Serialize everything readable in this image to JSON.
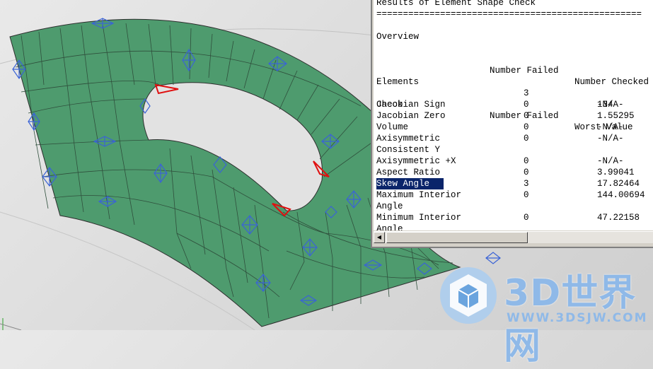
{
  "window_title": "Results of Element Shape Check",
  "separator": "==================================================",
  "overview": {
    "heading": "Overview",
    "col_failed": "Number Failed",
    "col_checked": "Number Checked",
    "row_label": "Elements",
    "failed": "3",
    "checked": "134"
  },
  "checks": {
    "col_check": "Check",
    "col_failed": "Number Failed",
    "col_worst": "Worst Value",
    "rows": [
      {
        "label": "Jacobian Sign",
        "failed": "0",
        "worst": "-N/A-"
      },
      {
        "label": "Jacobian Zero",
        "failed": "0",
        "worst": "1.55295"
      },
      {
        "label": "Volume",
        "failed": "0",
        "worst": "-N/A-"
      },
      {
        "label": "Axisymmetric",
        "failed": "0",
        "worst": "-N/A-"
      },
      {
        "label": "Consistent Y",
        "failed": "",
        "worst": ""
      },
      {
        "label": "Axisymmetric +X",
        "failed": "0",
        "worst": "-N/A-"
      },
      {
        "label": "Aspect Ratio",
        "failed": "0",
        "worst": "3.99041"
      },
      {
        "label": "Skew Angle",
        "failed": "3",
        "worst": "17.82464",
        "selected": true
      },
      {
        "label": "Maximum Interior",
        "failed": "0",
        "worst": "144.00694"
      },
      {
        "label": "Angle",
        "failed": "",
        "worst": ""
      },
      {
        "label": "Minimum Interior",
        "failed": "0",
        "worst": "47.22158"
      },
      {
        "label": "Angle",
        "failed": "",
        "worst": ""
      }
    ]
  },
  "watermark": {
    "title": "3D世界网",
    "url": "WWW.3DSJW.COM"
  },
  "colors": {
    "mesh_fill": "#4e9b6e",
    "mesh_line": "#3a3a3a",
    "constraint": "#3a63d6",
    "failed_element": "#e01010",
    "selection": "#0a246a"
  }
}
